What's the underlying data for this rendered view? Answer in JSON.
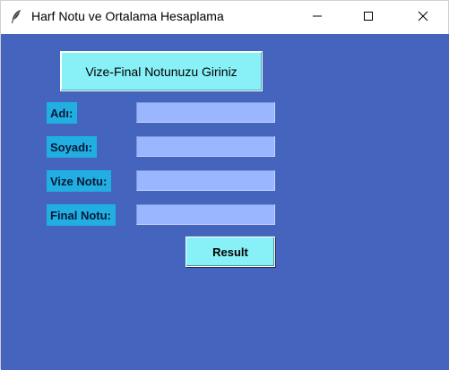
{
  "window": {
    "title": "Harf Notu ve Ortalama Hesaplama",
    "app_icon": "feather-icon",
    "controls": {
      "minimize_icon": "minimize-icon",
      "maximize_icon": "maximize-icon",
      "close_icon": "close-icon"
    }
  },
  "form": {
    "heading": "Vize-Final Notunuzu Giriniz",
    "fields": [
      {
        "label": "Adı:",
        "value": ""
      },
      {
        "label": "Soyadı:",
        "value": ""
      },
      {
        "label": "Vize Notu:",
        "value": ""
      },
      {
        "label": "Final Notu:",
        "value": ""
      }
    ],
    "submit_label": "Result"
  },
  "colors": {
    "background": "#4564be",
    "label_bg": "#21aee0",
    "input_bg": "#99b6ff",
    "button_bg": "#88f0f7"
  }
}
